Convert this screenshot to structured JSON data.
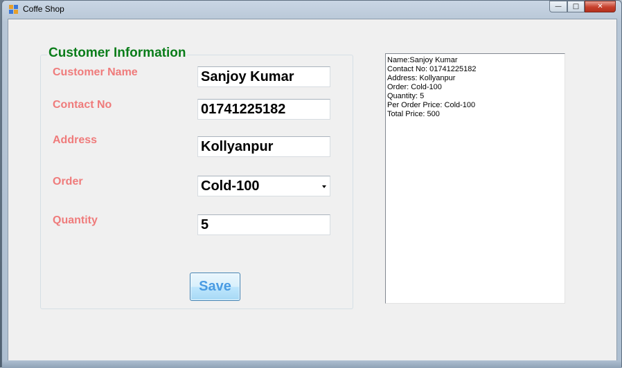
{
  "window": {
    "title": "Coffe Shop",
    "minimize_glyph": "—",
    "maximize_glyph": "□",
    "close_glyph": "✕"
  },
  "form": {
    "group_title": "Customer Information",
    "labels": {
      "name": "Customer Name",
      "contact": "Contact No",
      "address": "Address",
      "order": "Order",
      "quantity": "Quantity"
    },
    "values": {
      "name": "Sanjoy Kumar",
      "contact": "01741225182",
      "address": "Kollyanpur",
      "order": "Cold-100",
      "quantity": "5"
    },
    "save_label": "Save"
  },
  "output": {
    "lines": [
      "Name:Sanjoy Kumar",
      "Contact No: 01741225182",
      "Address: Kollyanpur",
      "Order: Cold-100",
      "Quantity: 5",
      "Per Order Price: Cold-100",
      "Total Price: 500"
    ]
  },
  "colors": {
    "group_title": "#0a7d1a",
    "label": "#ef7b7b",
    "save_text": "#4a9be3"
  },
  "icons": {
    "app": "app-icon",
    "combo_arrow": "chevron-down-icon"
  }
}
